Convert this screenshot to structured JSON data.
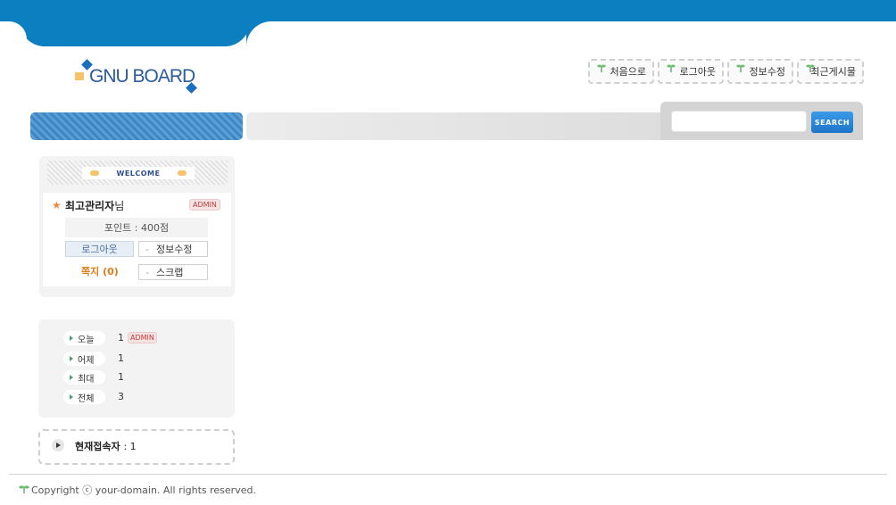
{
  "logo": {
    "text": "GNU BOARD"
  },
  "top_menu": [
    {
      "label": "처음으로"
    },
    {
      "label": "로그아웃"
    },
    {
      "label": "정보수정"
    },
    {
      "label": "최근게시물"
    }
  ],
  "search": {
    "value": "",
    "button_label": "SEARCH"
  },
  "welcome": {
    "header_label": "WELCOME",
    "user_name": "최고관리자",
    "user_suffix": "님",
    "badge": "ADMIN",
    "points": "포인트 : 400점",
    "logout_label": "로그아웃",
    "edit_label": "정보수정",
    "memo_label": "쪽지 (0)",
    "scrap_label": "스크랩",
    "dash": "-"
  },
  "visit": {
    "rows": [
      {
        "label": "오늘",
        "value": "1"
      },
      {
        "label": "어제",
        "value": "1"
      },
      {
        "label": "최대",
        "value": "1"
      },
      {
        "label": "전체",
        "value": "3"
      }
    ],
    "admin_badge": "ADMIN"
  },
  "connect": {
    "label": "현재접속자",
    "count": ": 1"
  },
  "footer": {
    "copyright": "Copyright ⓒ your-domain. All rights reserved."
  },
  "colors": {
    "brand_blue": "#0b7fc0",
    "accent_orange": "#e07b1a",
    "badge_red": "#c23d3d"
  }
}
